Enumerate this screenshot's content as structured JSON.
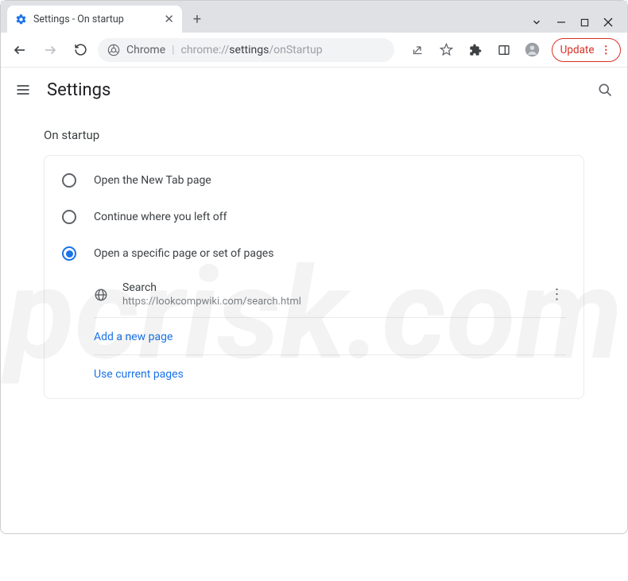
{
  "window": {
    "tab_title": "Settings - On startup"
  },
  "omnibox": {
    "app_label": "Chrome",
    "url_prefix": "chrome://",
    "url_mid": "settings",
    "url_suffix": "/onStartup"
  },
  "update_label": "Update",
  "header": {
    "title": "Settings"
  },
  "section_title": "On startup",
  "options": [
    {
      "label": "Open the New Tab page",
      "selected": false
    },
    {
      "label": "Continue where you left off",
      "selected": false
    },
    {
      "label": "Open a specific page or set of pages",
      "selected": true
    }
  ],
  "startup_page": {
    "name": "Search",
    "url": "https://lookcompwiki.com/search.html"
  },
  "links": {
    "add_page": "Add a new page",
    "use_current": "Use current pages"
  }
}
